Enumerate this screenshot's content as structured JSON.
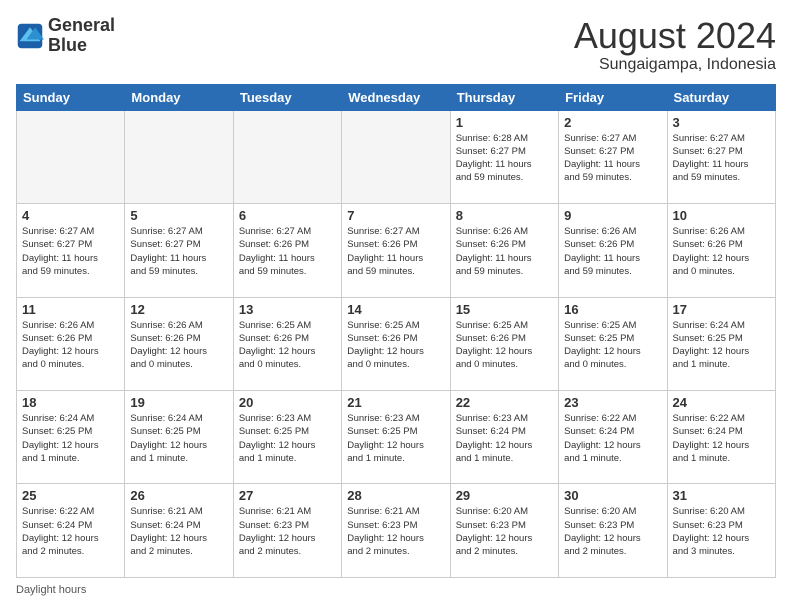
{
  "logo": {
    "line1": "General",
    "line2": "Blue"
  },
  "title": "August 2024",
  "subtitle": "Sungaigampa, Indonesia",
  "days_of_week": [
    "Sunday",
    "Monday",
    "Tuesday",
    "Wednesday",
    "Thursday",
    "Friday",
    "Saturday"
  ],
  "footer": "Daylight hours",
  "weeks": [
    [
      {
        "day": "",
        "info": ""
      },
      {
        "day": "",
        "info": ""
      },
      {
        "day": "",
        "info": ""
      },
      {
        "day": "",
        "info": ""
      },
      {
        "day": "1",
        "info": "Sunrise: 6:28 AM\nSunset: 6:27 PM\nDaylight: 11 hours\nand 59 minutes."
      },
      {
        "day": "2",
        "info": "Sunrise: 6:27 AM\nSunset: 6:27 PM\nDaylight: 11 hours\nand 59 minutes."
      },
      {
        "day": "3",
        "info": "Sunrise: 6:27 AM\nSunset: 6:27 PM\nDaylight: 11 hours\nand 59 minutes."
      }
    ],
    [
      {
        "day": "4",
        "info": "Sunrise: 6:27 AM\nSunset: 6:27 PM\nDaylight: 11 hours\nand 59 minutes."
      },
      {
        "day": "5",
        "info": "Sunrise: 6:27 AM\nSunset: 6:27 PM\nDaylight: 11 hours\nand 59 minutes."
      },
      {
        "day": "6",
        "info": "Sunrise: 6:27 AM\nSunset: 6:26 PM\nDaylight: 11 hours\nand 59 minutes."
      },
      {
        "day": "7",
        "info": "Sunrise: 6:27 AM\nSunset: 6:26 PM\nDaylight: 11 hours\nand 59 minutes."
      },
      {
        "day": "8",
        "info": "Sunrise: 6:26 AM\nSunset: 6:26 PM\nDaylight: 11 hours\nand 59 minutes."
      },
      {
        "day": "9",
        "info": "Sunrise: 6:26 AM\nSunset: 6:26 PM\nDaylight: 11 hours\nand 59 minutes."
      },
      {
        "day": "10",
        "info": "Sunrise: 6:26 AM\nSunset: 6:26 PM\nDaylight: 12 hours\nand 0 minutes."
      }
    ],
    [
      {
        "day": "11",
        "info": "Sunrise: 6:26 AM\nSunset: 6:26 PM\nDaylight: 12 hours\nand 0 minutes."
      },
      {
        "day": "12",
        "info": "Sunrise: 6:26 AM\nSunset: 6:26 PM\nDaylight: 12 hours\nand 0 minutes."
      },
      {
        "day": "13",
        "info": "Sunrise: 6:25 AM\nSunset: 6:26 PM\nDaylight: 12 hours\nand 0 minutes."
      },
      {
        "day": "14",
        "info": "Sunrise: 6:25 AM\nSunset: 6:26 PM\nDaylight: 12 hours\nand 0 minutes."
      },
      {
        "day": "15",
        "info": "Sunrise: 6:25 AM\nSunset: 6:26 PM\nDaylight: 12 hours\nand 0 minutes."
      },
      {
        "day": "16",
        "info": "Sunrise: 6:25 AM\nSunset: 6:25 PM\nDaylight: 12 hours\nand 0 minutes."
      },
      {
        "day": "17",
        "info": "Sunrise: 6:24 AM\nSunset: 6:25 PM\nDaylight: 12 hours\nand 1 minute."
      }
    ],
    [
      {
        "day": "18",
        "info": "Sunrise: 6:24 AM\nSunset: 6:25 PM\nDaylight: 12 hours\nand 1 minute."
      },
      {
        "day": "19",
        "info": "Sunrise: 6:24 AM\nSunset: 6:25 PM\nDaylight: 12 hours\nand 1 minute."
      },
      {
        "day": "20",
        "info": "Sunrise: 6:23 AM\nSunset: 6:25 PM\nDaylight: 12 hours\nand 1 minute."
      },
      {
        "day": "21",
        "info": "Sunrise: 6:23 AM\nSunset: 6:25 PM\nDaylight: 12 hours\nand 1 minute."
      },
      {
        "day": "22",
        "info": "Sunrise: 6:23 AM\nSunset: 6:24 PM\nDaylight: 12 hours\nand 1 minute."
      },
      {
        "day": "23",
        "info": "Sunrise: 6:22 AM\nSunset: 6:24 PM\nDaylight: 12 hours\nand 1 minute."
      },
      {
        "day": "24",
        "info": "Sunrise: 6:22 AM\nSunset: 6:24 PM\nDaylight: 12 hours\nand 1 minute."
      }
    ],
    [
      {
        "day": "25",
        "info": "Sunrise: 6:22 AM\nSunset: 6:24 PM\nDaylight: 12 hours\nand 2 minutes."
      },
      {
        "day": "26",
        "info": "Sunrise: 6:21 AM\nSunset: 6:24 PM\nDaylight: 12 hours\nand 2 minutes."
      },
      {
        "day": "27",
        "info": "Sunrise: 6:21 AM\nSunset: 6:23 PM\nDaylight: 12 hours\nand 2 minutes."
      },
      {
        "day": "28",
        "info": "Sunrise: 6:21 AM\nSunset: 6:23 PM\nDaylight: 12 hours\nand 2 minutes."
      },
      {
        "day": "29",
        "info": "Sunrise: 6:20 AM\nSunset: 6:23 PM\nDaylight: 12 hours\nand 2 minutes."
      },
      {
        "day": "30",
        "info": "Sunrise: 6:20 AM\nSunset: 6:23 PM\nDaylight: 12 hours\nand 2 minutes."
      },
      {
        "day": "31",
        "info": "Sunrise: 6:20 AM\nSunset: 6:23 PM\nDaylight: 12 hours\nand 3 minutes."
      }
    ]
  ]
}
